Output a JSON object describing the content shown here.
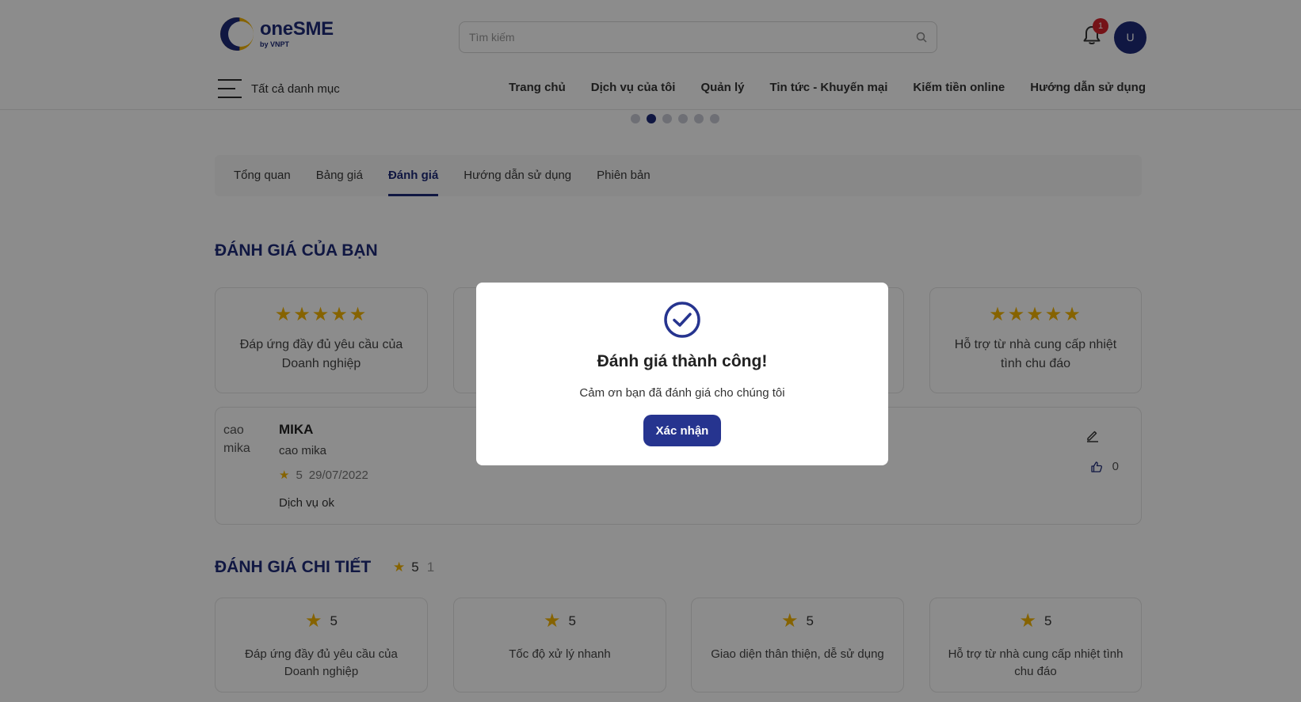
{
  "header": {
    "logo": {
      "name": "oneSME",
      "sub": "by VNPT"
    },
    "search": {
      "placeholder": "Tìm kiếm"
    },
    "notifications": {
      "count": "1"
    },
    "avatar": {
      "initial": "U"
    },
    "menu_label": "Tất cả danh mục",
    "nav": [
      "Trang chủ",
      "Dịch vụ của tôi",
      "Quản lý",
      "Tin tức - Khuyến mại",
      "Kiếm tiền online",
      "Hướng dẫn sử dụng"
    ]
  },
  "carousel": {
    "active_index": 1,
    "count": 6
  },
  "tabs": {
    "items": [
      "Tổng quan",
      "Bảng giá",
      "Đánh giá",
      "Hướng dẫn sử dụng",
      "Phiên bản"
    ],
    "active": "Đánh giá"
  },
  "your_rating": {
    "title": "ĐÁNH GIÁ CỦA BẠN",
    "criteria": [
      {
        "label": "Đáp ứng đầy đủ yêu cầu của Doanh nghiệp",
        "stars": 5
      },
      {
        "label": "Hỗ trợ từ nhà cung cấp nhiệt tình chu đáo",
        "stars": 5
      }
    ]
  },
  "review": {
    "image_alt": "cao mika",
    "name": "MIKA",
    "username": "cao mika",
    "rating": "5",
    "date": "29/07/2022",
    "comment": "Dịch vụ ok",
    "likes": "0"
  },
  "detail": {
    "title": "ĐÁNH GIÁ CHI TIẾT",
    "score": "5",
    "count": "1",
    "criteria": [
      {
        "label": "Đáp ứng đầy đủ yêu cầu của Doanh nghiệp",
        "score": "5"
      },
      {
        "label": "Tốc độ xử lý nhanh",
        "score": "5"
      },
      {
        "label": "Giao diện thân thiện, dễ sử dụng",
        "score": "5"
      },
      {
        "label": "Hỗ trợ từ nhà cung cấp nhiệt tình chu đáo",
        "score": "5"
      }
    ]
  },
  "modal": {
    "title": "Đánh giá thành công!",
    "message": "Cảm ơn bạn đã đánh giá cho chúng tôi",
    "confirm_label": "Xác nhận"
  },
  "colors": {
    "brand": "#1e2a78",
    "star": "#f4b400",
    "button": "#26348f",
    "badge": "#d6242c"
  }
}
